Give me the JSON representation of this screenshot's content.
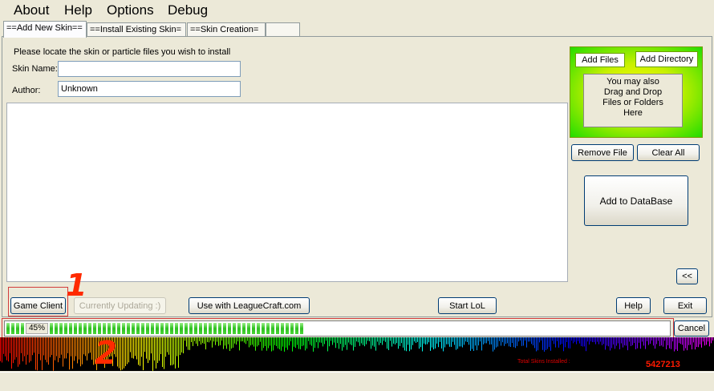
{
  "menu": {
    "about": "About",
    "help": "Help",
    "options": "Options",
    "debug": "Debug"
  },
  "tabs": [
    "==Add New Skin==",
    "==Install  Existing Skin=",
    "==Skin Creation=",
    ""
  ],
  "form": {
    "instruction": "Please locate the skin or particle files you wish to install",
    "skin_name_label": "Skin Name:",
    "skin_name_value": "",
    "author_label": "Author:",
    "author_value": "Unknown"
  },
  "dropzone": {
    "add_files": "Add Files",
    "add_directory": "Add Directory",
    "hint_lines": [
      "You may also",
      "Drag and Drop",
      "Files or Folders",
      "Here"
    ]
  },
  "side_buttons": {
    "remove_file": "Remove File",
    "clear_all": "Clear All",
    "add_to_database": "Add to DataBase",
    "collapse": "<<"
  },
  "bottom_buttons": {
    "game_client": "Game Client",
    "currently_updating": "Currently Updating :)",
    "use_with_leaguecraft": "Use with LeagueCraft.com",
    "start_lol": "Start LoL",
    "help": "Help",
    "exit": "Exit"
  },
  "progress": {
    "percent": 45,
    "label": "45%"
  },
  "cancel": "Cancel",
  "annotations": {
    "one": "1",
    "two": "2"
  },
  "status": {
    "label": "Total Skins Installed :",
    "count": "5427213"
  },
  "colors": {
    "accent_green": "#22dd00",
    "drop_yellow": "#ffff00",
    "annotation_red": "#ff2a00",
    "status_red": "#e00000"
  }
}
